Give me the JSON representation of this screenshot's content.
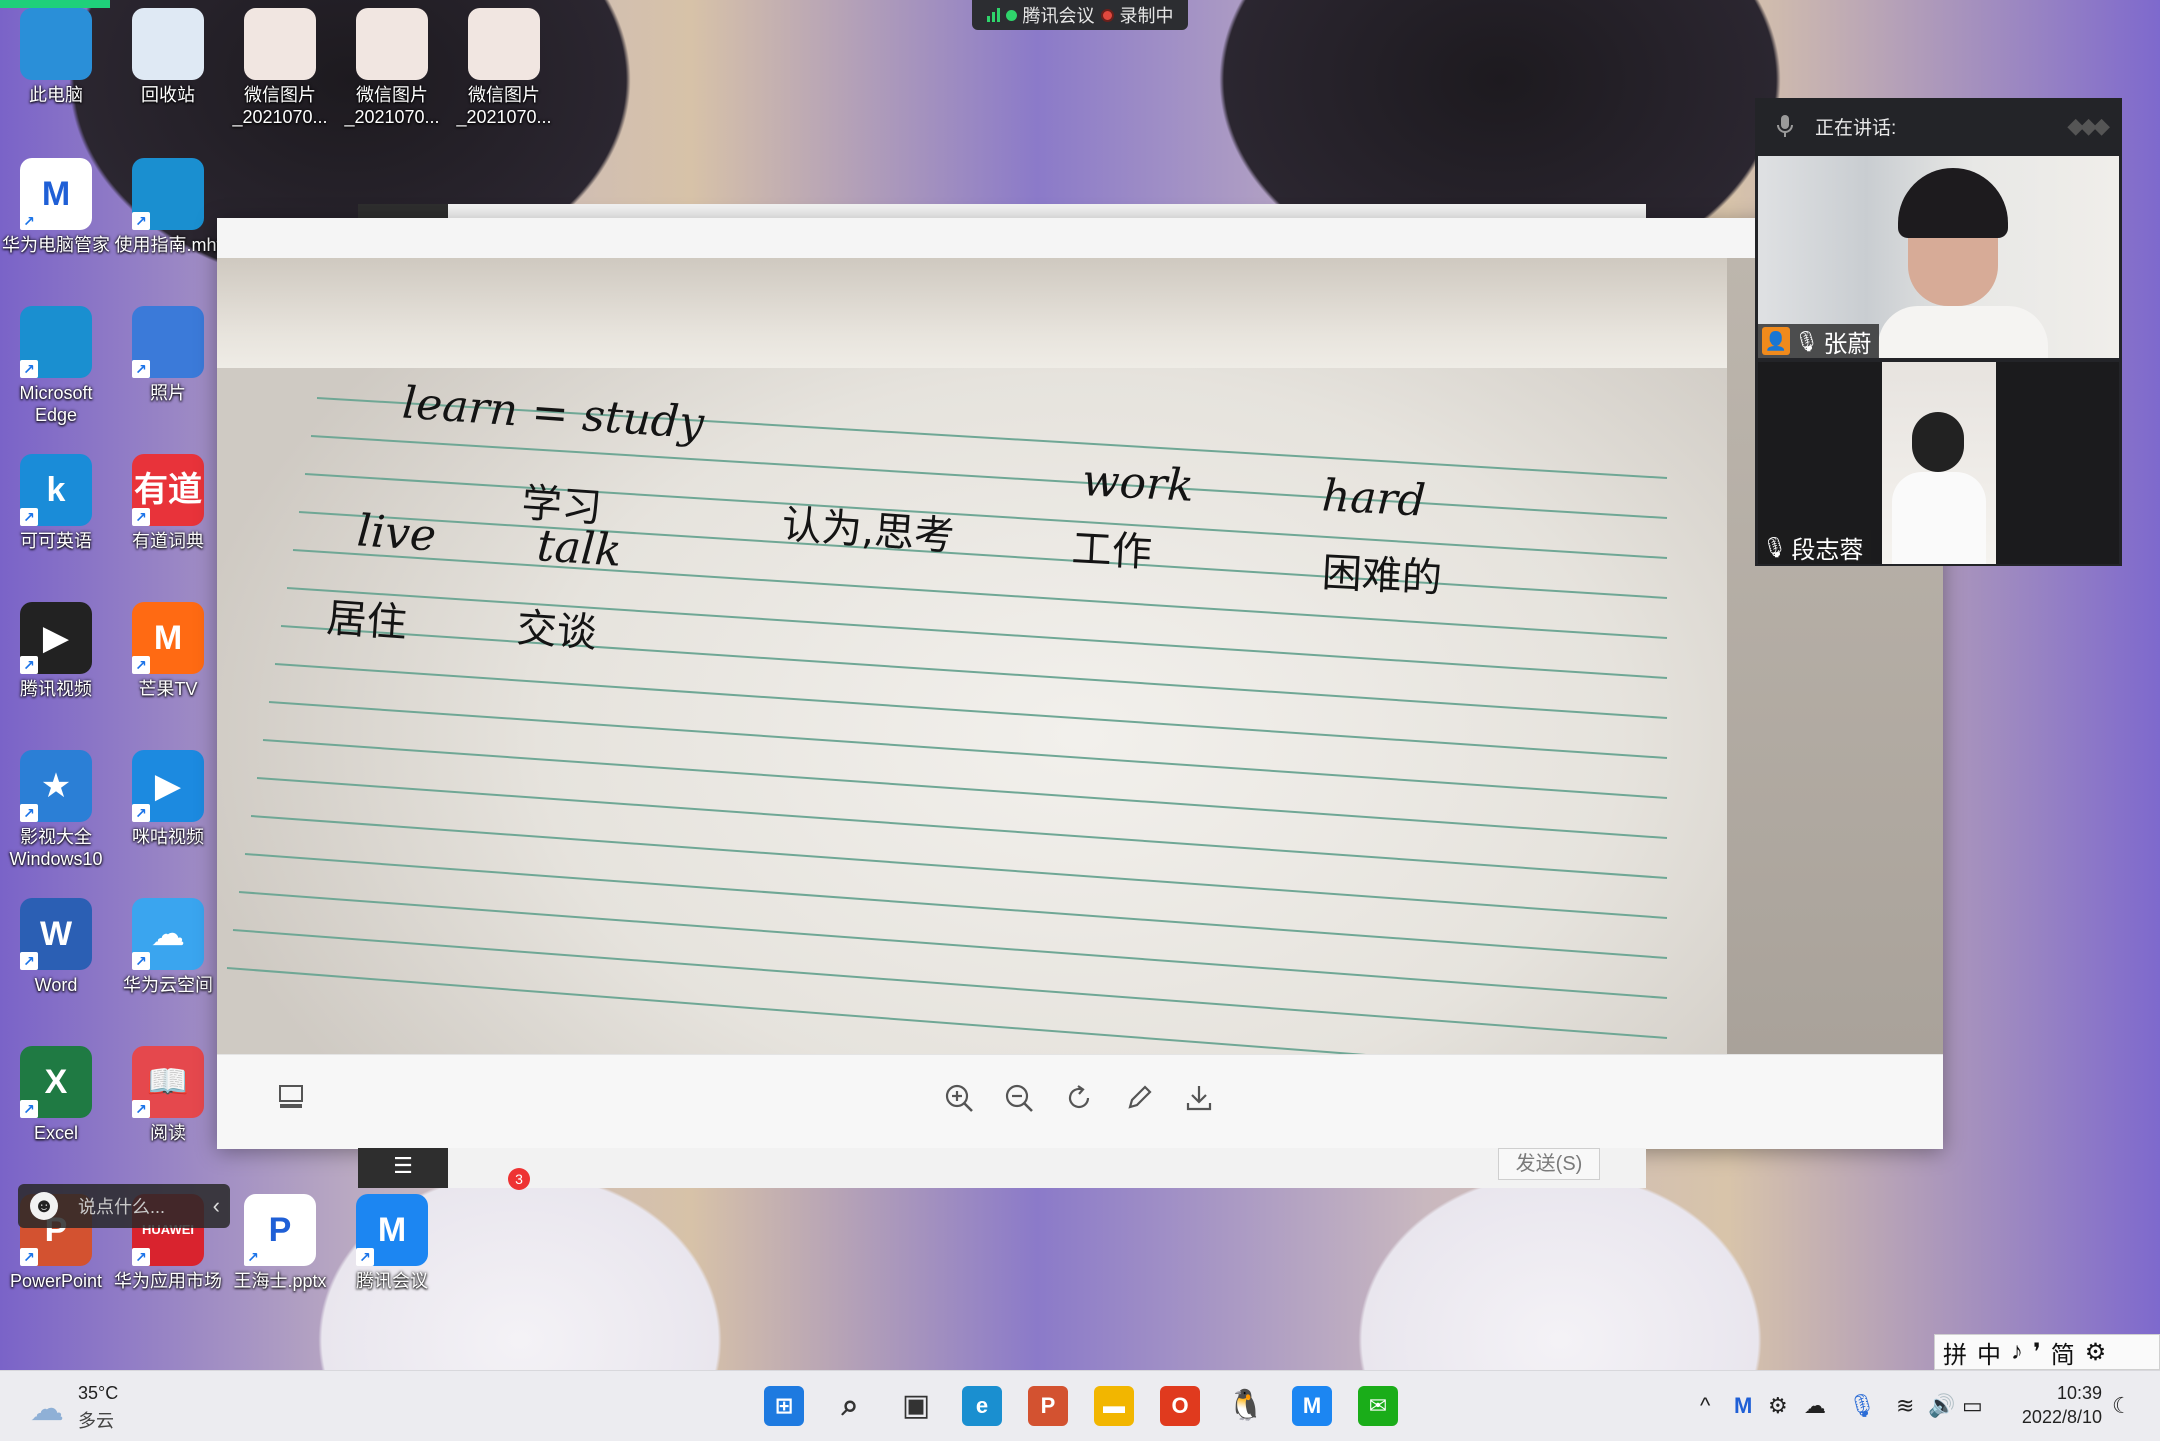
{
  "meeting_bar": {
    "app_name": "腾讯会议",
    "recording_label": "录制中",
    "signal_color": "#2fd46b",
    "record_color": "#e0483e"
  },
  "desktop_icons": [
    {
      "label": "此电脑",
      "icon": "monitor-icon",
      "color": "#2a8fd8"
    },
    {
      "label": "回收站",
      "icon": "recycle-bin-icon",
      "color": "#dfe9f4"
    },
    {
      "label": "微信图片_2021070...",
      "icon": "photo-thumbnail-icon",
      "color": "#f1e6e1"
    },
    {
      "label": "微信图片_2021070...",
      "icon": "photo-thumbnail-icon",
      "color": "#f1e6e1"
    },
    {
      "label": "微信图片_2021070...",
      "icon": "photo-thumbnail-icon",
      "color": "#f1e6e1"
    },
    {
      "label": "华为电脑管家",
      "icon": "huawei-manager-icon",
      "color": "#ffffff",
      "glyph": "M"
    },
    {
      "label": "使用指南.mht",
      "icon": "edge-icon",
      "color": "#1a8fd0"
    },
    {
      "label": "Microsoft Edge",
      "icon": "edge-icon",
      "color": "#1a8fd0"
    },
    {
      "label": "照片",
      "icon": "photos-icon",
      "color": "#3b7ad9"
    },
    {
      "label": "可可英语",
      "icon": "keke-english-icon",
      "color": "#1a8cd8",
      "glyph": "k"
    },
    {
      "label": "有道词典",
      "icon": "youdao-icon",
      "color": "#e8333a",
      "glyph": "有道"
    },
    {
      "label": "腾讯视频",
      "icon": "tencent-video-icon",
      "color": "#222222",
      "glyph": "▶"
    },
    {
      "label": "芒果TV",
      "icon": "mango-tv-icon",
      "color": "#ff6a13",
      "glyph": "M"
    },
    {
      "label": "影视大全Windows10",
      "icon": "video-collection-icon",
      "color": "#2b7fd6",
      "glyph": "★"
    },
    {
      "label": "咪咕视频",
      "icon": "migu-video-icon",
      "color": "#1c8ae0",
      "glyph": "▶"
    },
    {
      "label": "Word",
      "icon": "word-icon",
      "color": "#2b5fb4",
      "glyph": "W"
    },
    {
      "label": "华为云空间",
      "icon": "huawei-cloud-icon",
      "color": "#3aa5ef",
      "glyph": "☁"
    },
    {
      "label": "Excel",
      "icon": "excel-icon",
      "color": "#1f7a43",
      "glyph": "X"
    },
    {
      "label": "阅读",
      "icon": "reader-icon",
      "color": "#e5484d",
      "glyph": "📖"
    },
    {
      "label": "PowerPoint",
      "icon": "powerpoint-icon",
      "color": "#d35230",
      "glyph": "P"
    },
    {
      "label": "华为应用市场",
      "icon": "huawei-appgallery-icon",
      "color": "#d9232e",
      "glyph": "HUAWEI"
    },
    {
      "label": "王海士.pptx",
      "icon": "pptx-file-icon",
      "color": "#ffffff",
      "glyph": "P"
    },
    {
      "label": "腾讯会议",
      "icon": "tencent-meeting-icon",
      "color": "#1c86f2",
      "glyph": "M"
    }
  ],
  "notebook": {
    "words": [
      {
        "text": "learn = study",
        "kind": "en"
      },
      {
        "text": "学习",
        "kind": "cn"
      },
      {
        "text": "认为,思考",
        "kind": "cn"
      },
      {
        "text": "work",
        "kind": "en"
      },
      {
        "text": "hard",
        "kind": "en"
      },
      {
        "text": "live",
        "kind": "en"
      },
      {
        "text": "talk",
        "kind": "en"
      },
      {
        "text": "工作",
        "kind": "cn"
      },
      {
        "text": "困难的",
        "kind": "cn"
      },
      {
        "text": "居住",
        "kind": "cn"
      },
      {
        "text": "交谈",
        "kind": "cn"
      }
    ]
  },
  "viewer_toolbar": {
    "thumbnail": "thumbnail-icon",
    "zoom_in": "zoom-in-icon",
    "zoom_out": "zoom-out-icon",
    "rotate": "rotate-icon",
    "edit": "pencil-icon",
    "download": "download-icon"
  },
  "chat_window": {
    "send_label": "发送(S)",
    "unread_badge": "3"
  },
  "video_panel": {
    "speaking_label": "正在讲话:",
    "participants": [
      {
        "name": "张蔚"
      },
      {
        "name": "段志蓉"
      }
    ]
  },
  "comment": {
    "placeholder": "说点什么..."
  },
  "ime": {
    "items": [
      "拼",
      "中",
      "♪",
      "❜",
      "简",
      "⚙"
    ]
  },
  "taskbar": {
    "weather_temp": "35°C",
    "weather_desc": "多云",
    "time": "10:39",
    "date": "2022/8/10",
    "apps": [
      {
        "icon": "start-icon",
        "color": "#1e7ae0"
      },
      {
        "icon": "search-icon",
        "color": "#333333"
      },
      {
        "icon": "task-view-icon",
        "color": "#333333"
      },
      {
        "icon": "edge-icon",
        "color": "#1a8fd0"
      },
      {
        "icon": "powerpoint-icon",
        "color": "#d35230"
      },
      {
        "icon": "file-explorer-icon",
        "color": "#f2b600"
      },
      {
        "icon": "office-icon",
        "color": "#e03a1e"
      },
      {
        "icon": "qq-icon",
        "color": "#111111"
      },
      {
        "icon": "tencent-meeting-icon",
        "color": "#1c86f2"
      },
      {
        "icon": "wechat-icon",
        "color": "#1aad19"
      }
    ]
  }
}
